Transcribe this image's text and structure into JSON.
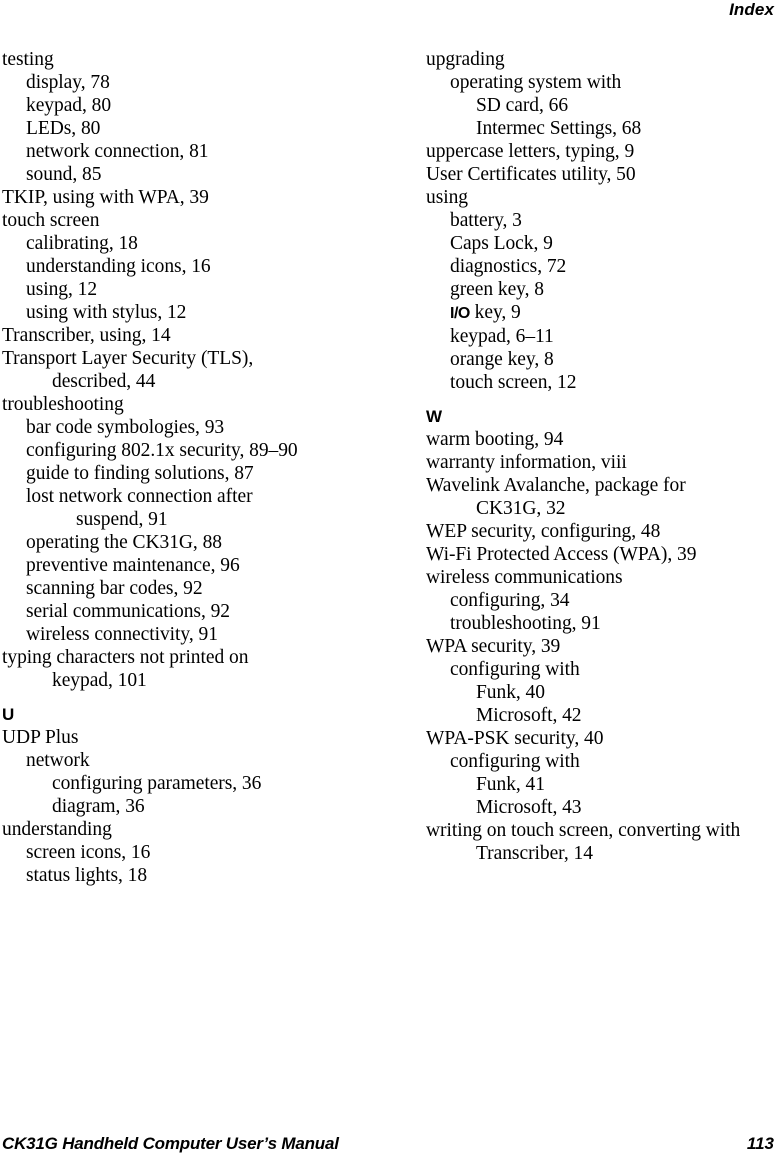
{
  "header": {
    "title": "Index"
  },
  "footer": {
    "manual_title": "CK31G Handheld Computer User’s Manual",
    "page_number": "113"
  },
  "columns": [
    {
      "name": "left",
      "entries": [
        {
          "level": 0,
          "text": "testing"
        },
        {
          "level": 1,
          "text": "display, 78"
        },
        {
          "level": 1,
          "text": "keypad, 80"
        },
        {
          "level": 1,
          "text": "LEDs, 80"
        },
        {
          "level": 1,
          "text": "network connection, 81"
        },
        {
          "level": 1,
          "text": "sound, 85"
        },
        {
          "level": 0,
          "text": "TKIP, using with WPA, 39"
        },
        {
          "level": 0,
          "text": "touch screen"
        },
        {
          "level": 1,
          "text": "calibrating, 18"
        },
        {
          "level": 1,
          "text": "understanding icons, 16"
        },
        {
          "level": 1,
          "text": "using, 12"
        },
        {
          "level": 1,
          "text": "using with stylus, 12"
        },
        {
          "level": 0,
          "text": "Transcriber, using, 14"
        },
        {
          "level": 0,
          "text": "Transport Layer Security (TLS),"
        },
        {
          "level": 2,
          "text": "described, 44"
        },
        {
          "level": 0,
          "text": "troubleshooting"
        },
        {
          "level": 1,
          "text": "bar code symbologies, 93"
        },
        {
          "level": 1,
          "text": "configuring 802.1x security, 89–90"
        },
        {
          "level": 1,
          "text": "guide to finding solutions, 87"
        },
        {
          "level": 1,
          "text": "lost network connection after"
        },
        {
          "level": 3,
          "text": "suspend, 91"
        },
        {
          "level": 1,
          "text": "operating the CK31G, 88"
        },
        {
          "level": 1,
          "text": "preventive maintenance, 96"
        },
        {
          "level": 1,
          "text": "scanning bar codes, 92"
        },
        {
          "level": 1,
          "text": "serial communications, 92"
        },
        {
          "level": 1,
          "text": "wireless connectivity, 91"
        },
        {
          "level": 0,
          "text": "typing characters not printed on"
        },
        {
          "level": 2,
          "text": "keypad, 101"
        },
        {
          "level": 0,
          "text": "U",
          "section": true
        },
        {
          "level": 0,
          "text": "UDP Plus"
        },
        {
          "level": 1,
          "text": "network"
        },
        {
          "level": 2,
          "text": "configuring parameters, 36"
        },
        {
          "level": 2,
          "text": "diagram, 36"
        },
        {
          "level": 0,
          "text": "understanding"
        },
        {
          "level": 1,
          "text": "screen icons, 16"
        },
        {
          "level": 1,
          "text": "status lights, 18"
        }
      ]
    },
    {
      "name": "right",
      "entries": [
        {
          "level": 0,
          "text": "upgrading"
        },
        {
          "level": 1,
          "text": "operating system with"
        },
        {
          "level": 2,
          "text": "SD card, 66"
        },
        {
          "level": 2,
          "text": "Intermec Settings, 68"
        },
        {
          "level": 0,
          "text": "uppercase letters, typing, 9"
        },
        {
          "level": 0,
          "text": "User Certificates utility, 50"
        },
        {
          "level": 0,
          "text": "using"
        },
        {
          "level": 1,
          "text": "battery, 3"
        },
        {
          "level": 1,
          "text": "Caps Lock, 9"
        },
        {
          "level": 1,
          "text": "diagnostics, 72"
        },
        {
          "level": 1,
          "text": "green key, 8"
        },
        {
          "level": 1,
          "text": "Ⅰₒ key, 9",
          "glyph": "io-key",
          "glyph_text": "I/O",
          "rest_text": " key, 9"
        },
        {
          "level": 1,
          "text": "keypad, 6–11"
        },
        {
          "level": 1,
          "text": "orange key, 8"
        },
        {
          "level": 1,
          "text": "touch screen, 12"
        },
        {
          "level": 0,
          "text": "W",
          "section": true
        },
        {
          "level": 0,
          "text": "warm booting, 94"
        },
        {
          "level": 0,
          "text": "warranty information, viii"
        },
        {
          "level": 0,
          "text": "Wavelink Avalanche, package for"
        },
        {
          "level": 2,
          "text": "CK31G, 32"
        },
        {
          "level": 0,
          "text": "WEP security, configuring, 48"
        },
        {
          "level": 0,
          "text": "Wi-Fi Protected Access (WPA), 39"
        },
        {
          "level": 0,
          "text": "wireless communications"
        },
        {
          "level": 1,
          "text": "configuring, 34"
        },
        {
          "level": 1,
          "text": "troubleshooting, 91"
        },
        {
          "level": 0,
          "text": "WPA security, 39"
        },
        {
          "level": 1,
          "text": "configuring with"
        },
        {
          "level": 2,
          "text": "Funk, 40"
        },
        {
          "level": 2,
          "text": "Microsoft, 42"
        },
        {
          "level": 0,
          "text": "WPA-PSK security, 40"
        },
        {
          "level": 1,
          "text": "configuring with"
        },
        {
          "level": 2,
          "text": "Funk, 41"
        },
        {
          "level": 2,
          "text": "Microsoft, 43"
        },
        {
          "level": 0,
          "text": "writing on touch screen, converting with"
        },
        {
          "level": 2,
          "text": "Transcriber, 14"
        }
      ]
    }
  ]
}
